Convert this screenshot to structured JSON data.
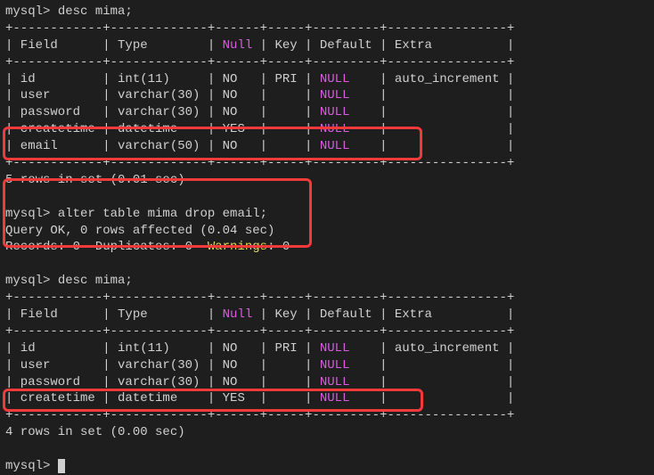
{
  "prompt": "mysql> ",
  "cmd1": "desc mima;",
  "t1": {
    "sep": "+------------+-------------+------+-----+---------+----------------+",
    "hdr_a": "| Field      | Type        | ",
    "hdr_null": "Null",
    "hdr_b": " | Key | Default | Extra          |",
    "r1a": "| id         | int(11)     | NO   | PRI | ",
    "r1n": "NULL",
    "r1b": "    | auto_increment |",
    "r2a": "| user       | varchar(30) | NO   |     | ",
    "r2n": "NULL",
    "r2b": "    |                |",
    "r3a": "| password   | varchar(30) | NO   |     | ",
    "r3n": "NULL",
    "r3b": "    |                |",
    "r4a": "| createtime | datetime    | YES  |     | ",
    "r4n": "NULL",
    "r4b": "    |                |",
    "r5a": "| email      | varchar(50) | NO   |     | ",
    "r5n": "NULL",
    "r5b": "    |                |"
  },
  "rows1": "5 rows in set (0.01 sec)",
  "cmd2": "alter table mima drop email;",
  "res1": "Query OK, 0 rows affected (0.04 sec)",
  "res2a": "Records: 0  Duplicates: 0  ",
  "res2warn": "Warnings",
  "res2b": ": 0",
  "cmd3": "desc mima;",
  "t2": {
    "sep": "+------------+-------------+------+-----+---------+----------------+",
    "hdr_a": "| Field      | Type        | ",
    "hdr_null": "Null",
    "hdr_b": " | Key | Default | Extra          |",
    "r1a": "| id         | int(11)     | NO   | PRI | ",
    "r1n": "NULL",
    "r1b": "    | auto_increment |",
    "r2a": "| user       | varchar(30) | NO   |     | ",
    "r2n": "NULL",
    "r2b": "    |                |",
    "r3a": "| password   | varchar(30) | NO   |     | ",
    "r3n": "NULL",
    "r3b": "    |                |",
    "r4a": "| createtime | datetime    | YES  |     | ",
    "r4n": "NULL",
    "r4b": "    |                |"
  },
  "rows2": "4 rows in set (0.00 sec)"
}
